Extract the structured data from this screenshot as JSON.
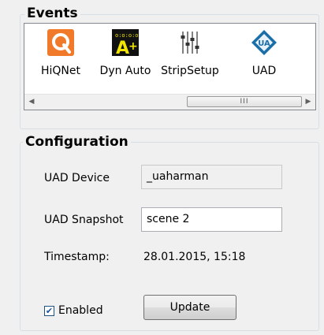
{
  "events": {
    "title": "Events",
    "items": [
      {
        "label": "HiQNet",
        "icon": "hiqnet-icon"
      },
      {
        "label": "Dyn Auto",
        "icon": "dyn-auto-icon"
      },
      {
        "label": "StripSetup",
        "icon": "strip-setup-icon"
      },
      {
        "label": "UAD",
        "icon": "uad-icon"
      }
    ],
    "scrollbar": {
      "left_arrow": "◀",
      "right_arrow": "▶",
      "thumb_grip": "III"
    }
  },
  "configuration": {
    "title": "Configuration",
    "uad_device_label": "UAD Device",
    "uad_device_value": "_uaharman",
    "uad_snapshot_label": "UAD Snapshot",
    "uad_snapshot_value": "scene 2",
    "timestamp_label": "Timestamp:",
    "timestamp_value": "28.01.2015, 15:18",
    "enabled_label": "Enabled",
    "enabled_checked": true,
    "update_button": "Update"
  },
  "colors": {
    "hiqnet_orange": "#f07a2a",
    "dyn_auto_yellow": "#f2e600",
    "uad_blue": "#1b6fa8"
  }
}
